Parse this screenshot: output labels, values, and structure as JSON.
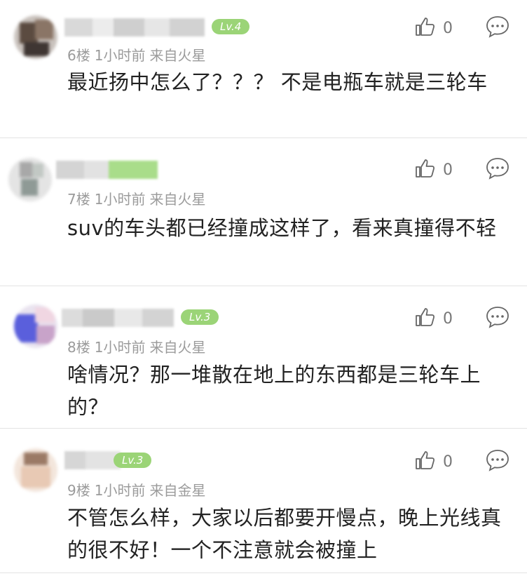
{
  "comments": [
    {
      "level": "Lv.4",
      "floor": "6楼",
      "time": "1小时前",
      "source": "来自火星",
      "text": "最近扬中怎么了？？？ 不是电瓶车就是三轮车",
      "likes": "0"
    },
    {
      "level": "",
      "floor": "7楼",
      "time": "1小时前",
      "source": "来自火星",
      "text": "suv的车头都已经撞成这样了，看来真撞得不轻",
      "likes": "0"
    },
    {
      "level": "Lv.3",
      "floor": "8楼",
      "time": "1小时前",
      "source": "来自火星",
      "text": "啥情况？那一堆散在地上的东西都是三轮车上的？",
      "likes": "0"
    },
    {
      "level": "Lv.3",
      "floor": "9楼",
      "time": "1小时前",
      "source": "来自金星",
      "text": "不管怎么样，大家以后都要开慢点，晚上光线真的很不好！一个不注意就会被撞上",
      "likes": "0"
    }
  ],
  "icons": {
    "like": "thumbs-up-icon",
    "reply": "comment-bubble-icon"
  },
  "colors": {
    "level_badge": "#9bd477",
    "meta_text": "#9b9b9b",
    "body_text": "#222222",
    "divider": "#e3e3e3"
  }
}
